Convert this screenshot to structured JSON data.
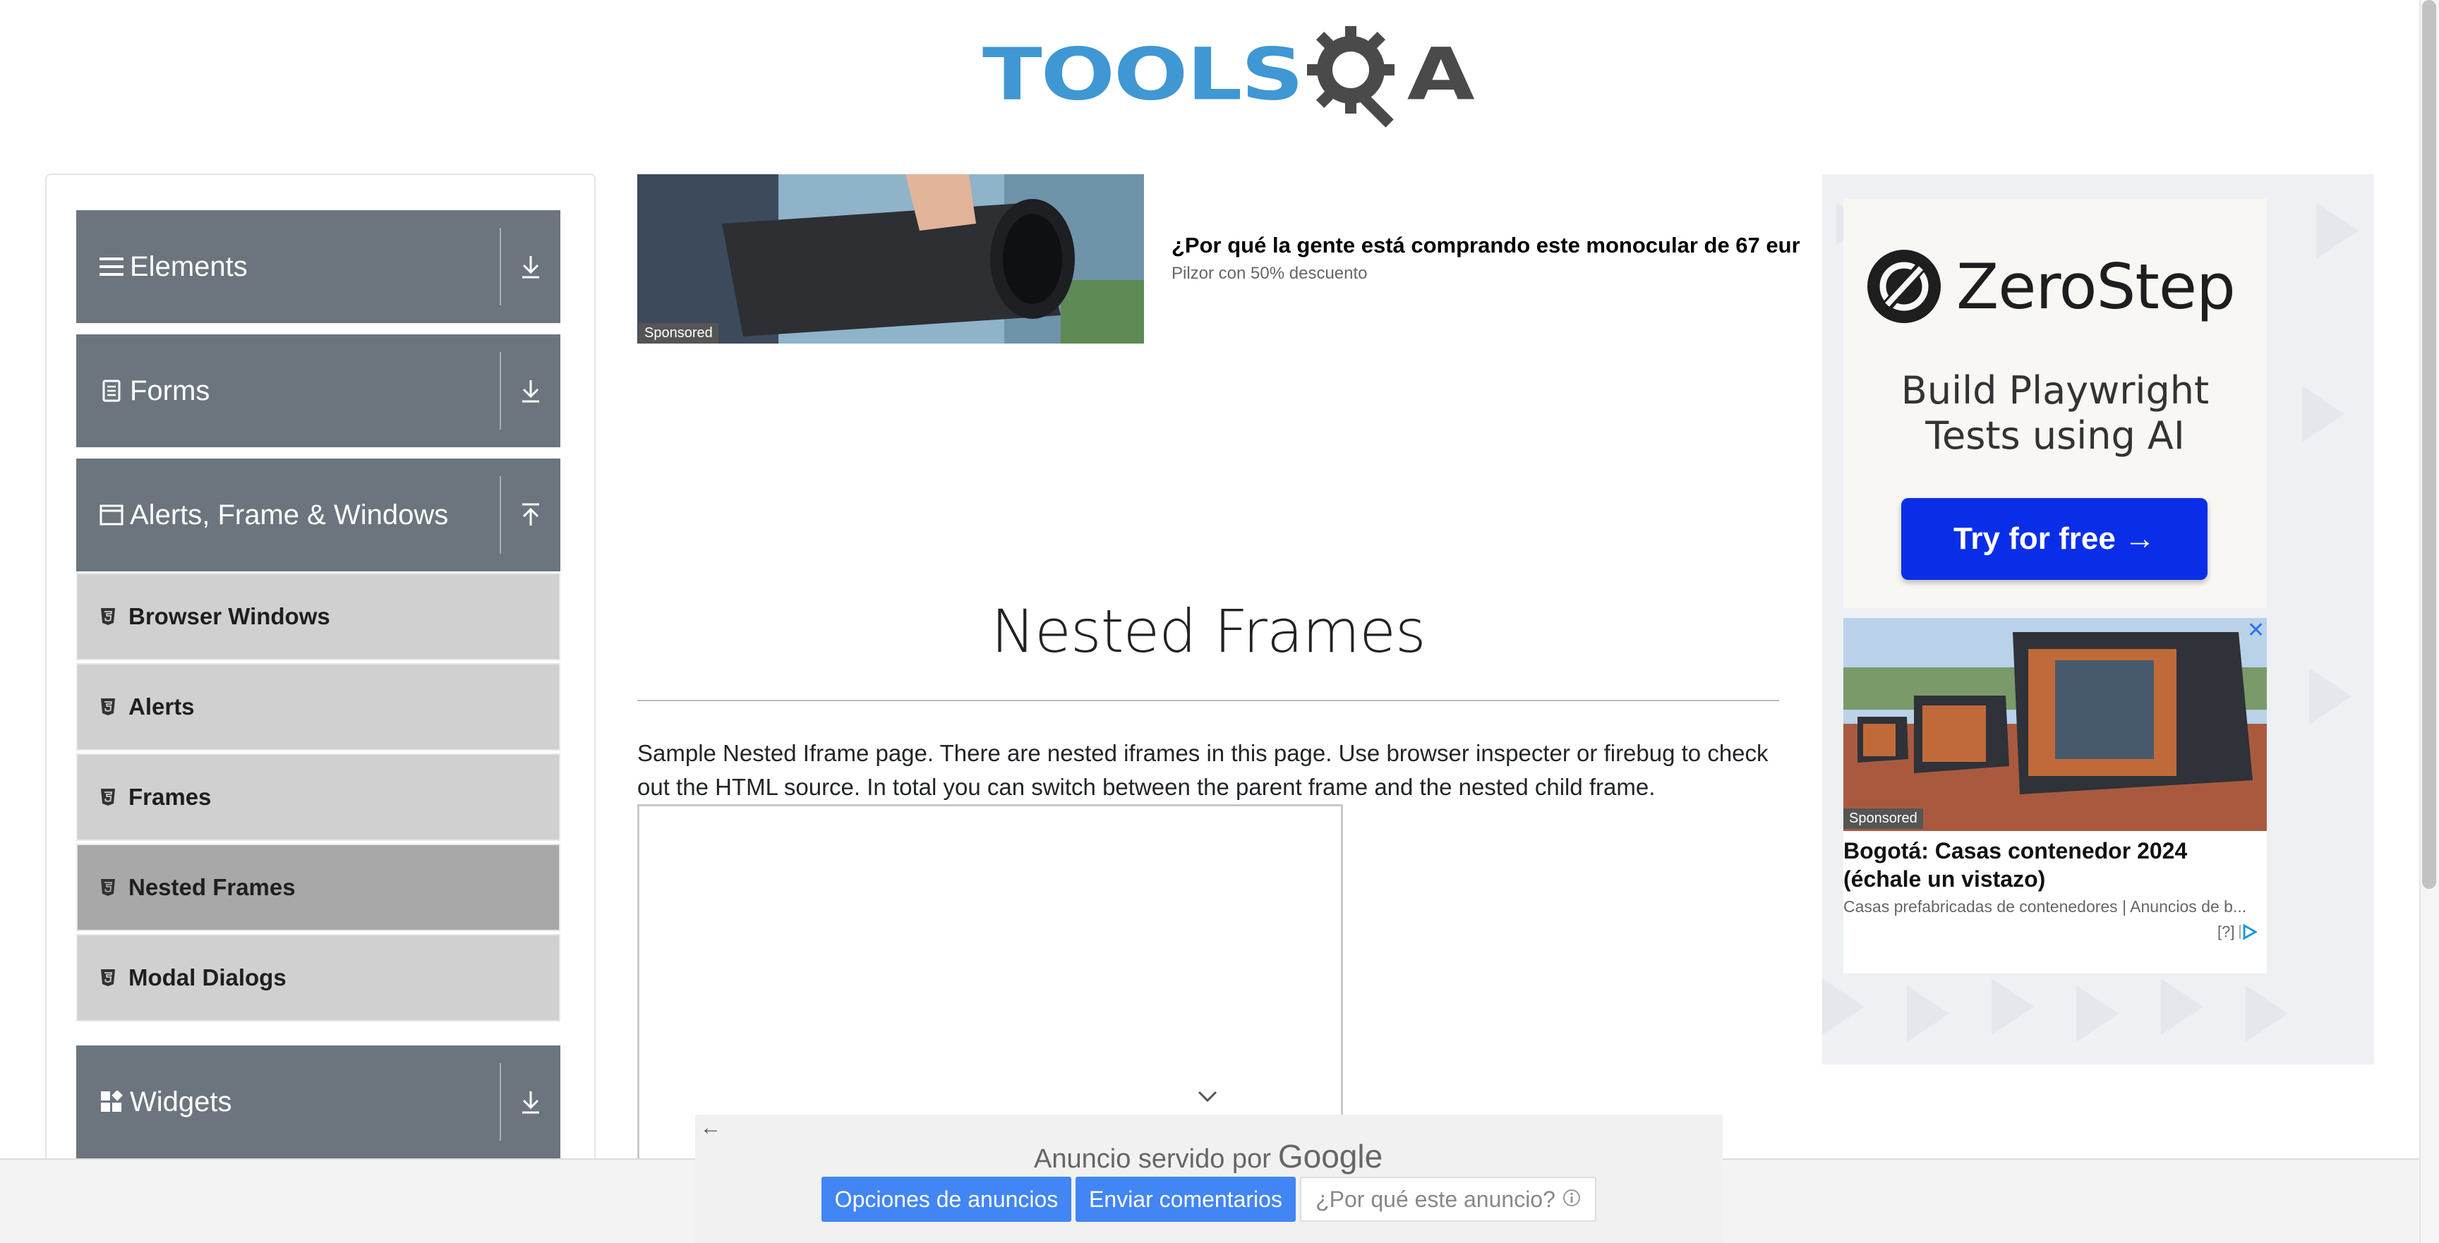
{
  "header": {
    "logo_part1": "TOOLS",
    "logo_part2": "A",
    "logo_alt": "TOOLSQA"
  },
  "sidebar": {
    "groups": [
      {
        "label": "Elements",
        "icon": "list-icon",
        "expanded": false
      },
      {
        "label": "Forms",
        "icon": "form-icon",
        "expanded": false
      },
      {
        "label": "Alerts, Frame & Windows",
        "icon": "window-icon",
        "expanded": true
      },
      {
        "label": "Widgets",
        "icon": "widgets-icon",
        "expanded": false
      }
    ],
    "items": [
      {
        "label": "Browser Windows",
        "active": false
      },
      {
        "label": "Alerts",
        "active": false
      },
      {
        "label": "Frames",
        "active": false
      },
      {
        "label": "Nested Frames",
        "active": true
      },
      {
        "label": "Modal Dialogs",
        "active": false
      }
    ]
  },
  "top_ad": {
    "sponsored": "Sponsored",
    "headline": "¿Por qué la gente está comprando este monocular de 67 eur",
    "subtext": "Pilzor con 50% descuento"
  },
  "main": {
    "title": "Nested Frames",
    "description": "Sample Nested Iframe page. There are nested iframes in this page. Use browser inspecter or firebug to check out the HTML source. In total you can switch between the parent frame and the nested child frame."
  },
  "right_ad": {
    "brand": "ZeroStep",
    "tagline_line1": "Build Playwright",
    "tagline_line2": "Tests using AI",
    "cta": "Try for free →",
    "close": "✕",
    "sponsored": "Sponsored",
    "headline": "Bogotá: Casas contenedor 2024 (échale un vistazo)",
    "subtext": "Casas prefabricadas de contenedores | Anuncios de b...",
    "adchoices": "[?]"
  },
  "google_ad_bar": {
    "served_by": "Anuncio servido por",
    "google": "Google",
    "btn_options": "Opciones de anuncios",
    "btn_feedback": "Enviar comentarios",
    "btn_why": "¿Por qué este anuncio?"
  },
  "colors": {
    "sidebar_group": "#6c757d",
    "sidebar_item": "#d0d0d0",
    "sidebar_active": "#a8a8a8",
    "logo_blue": "#3f97d4",
    "cta_blue": "#0a2ee8",
    "google_blue": "#4285f4"
  }
}
